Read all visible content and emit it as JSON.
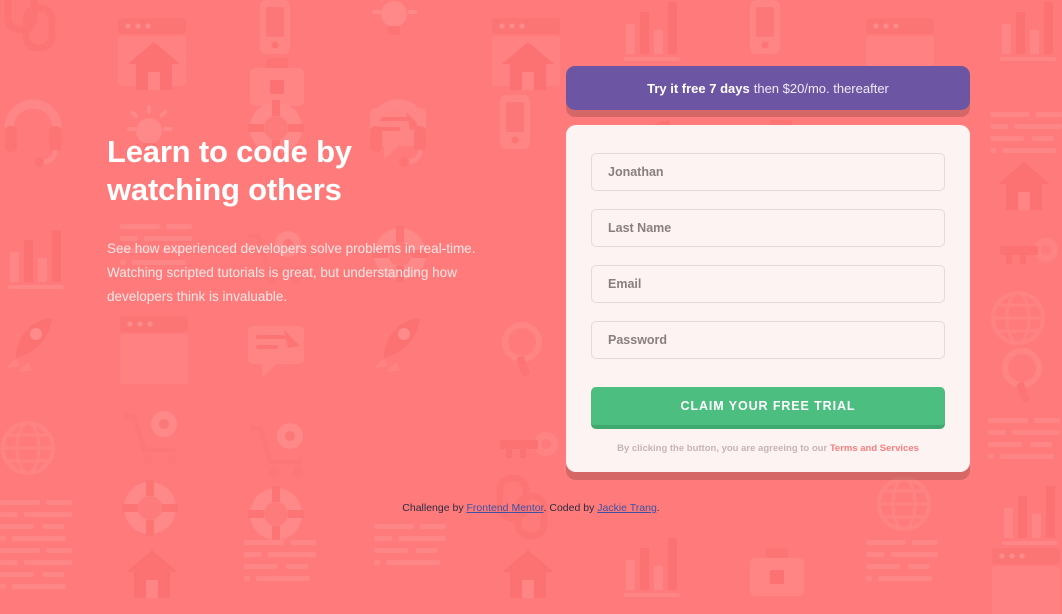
{
  "theme": {
    "background_color": "#ff7b7b",
    "banner_color": "#6c56a4",
    "card_color": "#fdf3f3",
    "cta_color": "#4cbe80",
    "cta_shadow_color": "#3fa86e",
    "terms_link_color": "#fc7f7f",
    "attribution_link_color": "#3e52a3",
    "heading_color": "#ffffff",
    "body_text_color": "#fde6e6",
    "input_border_color": "#e3dbdb",
    "input_text_color": "#8a7f7f"
  },
  "hero": {
    "title": "Learn to code by watching others",
    "description": "See how experienced developers solve problems in real-time. Watching scripted tutorials is great, but understanding how developers think is invaluable."
  },
  "promo_banner": {
    "strong_text": "Try it free 7 days",
    "rest_text": "then $20/mo. thereafter"
  },
  "signup_form": {
    "fields": [
      {
        "name": "first-name",
        "placeholder": "Jonathan",
        "value": "",
        "type": "text"
      },
      {
        "name": "last-name",
        "placeholder": "Last Name",
        "value": "",
        "type": "text"
      },
      {
        "name": "email",
        "placeholder": "Email",
        "value": "",
        "type": "email"
      },
      {
        "name": "password",
        "placeholder": "Password",
        "value": "",
        "type": "password"
      }
    ],
    "submit_label": "CLAIM YOUR FREE TRIAL",
    "terms_prefix": "By clicking the button, you are agreeing to our ",
    "terms_link_label": "Terms and Services"
  },
  "attribution": {
    "prefix": "Challenge by ",
    "challenge_link": "Frontend Mentor",
    "middle": ". Coded by ",
    "author_link": "Jackie Trang",
    "suffix": "."
  },
  "background_pattern": {
    "icon_names": [
      "link-icon",
      "browser-window-icon",
      "home-icon",
      "bar-chart-icon",
      "headset-icon",
      "toolbox-icon",
      "mobile-icon",
      "lightbulb-icon",
      "rocket-icon",
      "gear-cart-icon",
      "globe-icon",
      "lifebuoy-icon",
      "key-icon",
      "magnifier-icon",
      "chat-icon",
      "document-icon"
    ],
    "light_tint": "#ff8a8a",
    "dark_tint": "#fa7272",
    "accent_tint": "#ff9393"
  }
}
